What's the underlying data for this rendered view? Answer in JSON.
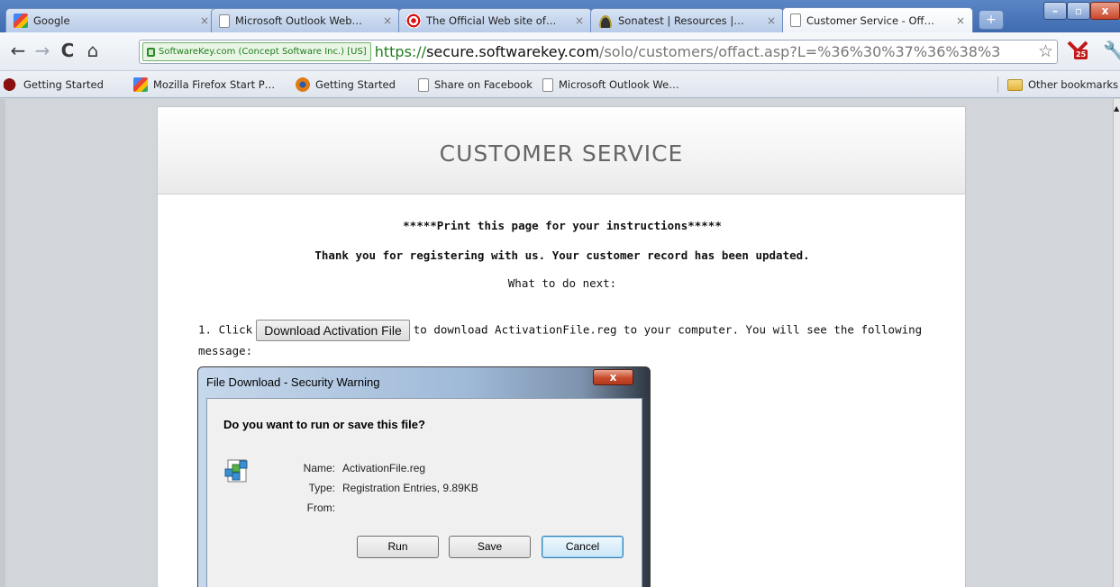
{
  "tabs": [
    {
      "title": "Google",
      "icon": "google-icon"
    },
    {
      "title": "Microsoft Outlook Web…",
      "icon": "page-icon"
    },
    {
      "title": "The Official Web site of…",
      "icon": "target-icon"
    },
    {
      "title": "Sonatest | Resources |…",
      "icon": "sonatest-icon"
    },
    {
      "title": "Customer Service - Off…",
      "icon": "page-icon",
      "active": true
    }
  ],
  "tab_close_glyph": "×",
  "new_tab_glyph": "+",
  "window_buttons": {
    "minimize": "–",
    "maximize": "▫",
    "close": "x"
  },
  "toolbar": {
    "back": "←",
    "forward": "→",
    "reload": "C",
    "home": "⌂",
    "ev_label": "SoftwareKey.com (Concept Software Inc.) [US]",
    "url_scheme": "https://",
    "url_host": "secure.softwarekey.com",
    "url_path": "/solo/customers/offact.asp?L=%36%30%37%36%38%3",
    "star": "☆",
    "ext_badge": "25",
    "wrench": "🔧"
  },
  "bookmarks": [
    {
      "label": "Getting Started",
      "icon": "bird-icon"
    },
    {
      "label": "Mozilla Firefox Start P…",
      "icon": "google-icon"
    },
    {
      "label": "Getting Started",
      "icon": "firefox-icon"
    },
    {
      "label": "Share on Facebook",
      "icon": "page-icon"
    },
    {
      "label": "Microsoft Outlook We…",
      "icon": "page-icon"
    }
  ],
  "other_bookmarks": "Other bookmarks",
  "page": {
    "title": "CUSTOMER SERVICE",
    "print_line": "*****Print this page for your instructions*****",
    "thanks_line": "Thank you for registering with us. Your customer record has been updated.",
    "next_line": "What to do next:",
    "step1_prefix": "1. Click",
    "download_button": "Download Activation File",
    "step1_suffix": "to download ActivationFile.reg to your computer. You will see the following message:"
  },
  "dialog": {
    "title": "File Download - Security Warning",
    "close": "x",
    "question": "Do you want to run or save this file?",
    "name_label": "Name:",
    "name_value": "ActivationFile.reg",
    "type_label": "Type:",
    "type_value": "Registration Entries, 9.89KB",
    "from_label": "From:",
    "from_value": "",
    "run": "Run",
    "save": "Save",
    "cancel": "Cancel"
  },
  "colors": {
    "tabstrip": "#4a78bb",
    "ev_green": "#1e7d1e",
    "title_gray": "#666666"
  }
}
